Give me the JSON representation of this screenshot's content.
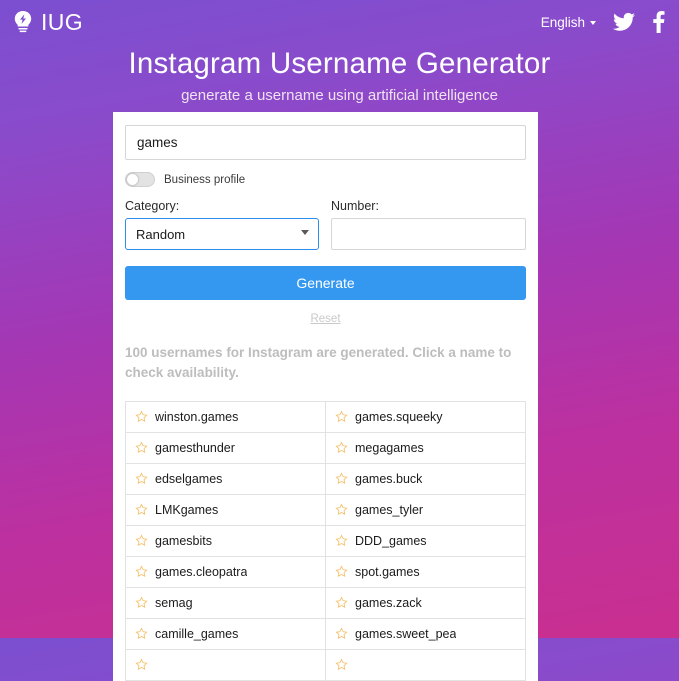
{
  "theme": {
    "gradient_start": "#7b4fd0",
    "gradient_end": "#c92f8f",
    "accent_blue": "#3498f0",
    "star_color": "#f5c16c"
  },
  "topbar": {
    "brand": "IUG",
    "brand_icon": "lightbulb-icon",
    "language": "English",
    "language_caret_icon": "chevron-down-icon",
    "twitter_icon": "twitter-icon",
    "facebook_icon": "facebook-icon"
  },
  "hero": {
    "title": "Instagram Username Generator",
    "subtitle": "generate a username using artificial intelligence"
  },
  "form": {
    "keyword_value": "games",
    "keyword_placeholder": "",
    "business_profile_label": "Business profile",
    "business_profile_on": false,
    "category_label": "Category:",
    "category_value": "Random",
    "category_options": [
      "Random"
    ],
    "number_label": "Number:",
    "number_value": "",
    "number_placeholder": "",
    "generate_label": "Generate",
    "reset_label": "Reset"
  },
  "results": {
    "status": "100 usernames for Instagram are generated. Click a name to check availability.",
    "star_icon": "star-outline-icon",
    "left_column": [
      "winston.games",
      "gamesthunder",
      "edselgames",
      "LMKgames",
      "gamesbits",
      "games.cleopatra",
      "semag",
      "camille_games",
      ""
    ],
    "right_column": [
      "games.squeeky",
      "megagames",
      "games.buck",
      "games_tyler",
      "DDD_games",
      "spot.games",
      "games.zack",
      "games.sweet_pea",
      ""
    ]
  }
}
